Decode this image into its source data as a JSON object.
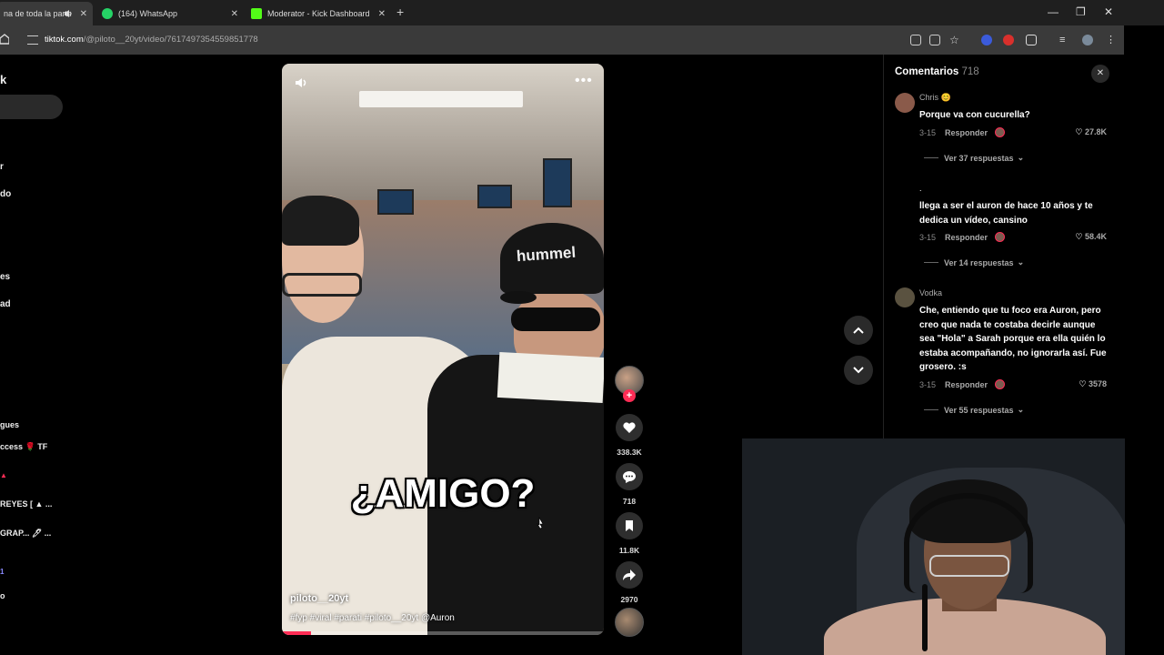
{
  "browser": {
    "tabs": [
      {
        "title": "na de toda la parte",
        "icon": "speaker-icon"
      },
      {
        "title": "(164) WhatsApp",
        "icon": "whatsapp-icon"
      },
      {
        "title": "Moderator - Kick Dashboard",
        "icon": "kick-icon"
      }
    ],
    "url_domain": "tiktok.com",
    "url_path": "/@piloto__20yt/video/7617497354559851778"
  },
  "sidebar": {
    "items": [
      {
        "label": "k"
      },
      {
        "label": "r"
      },
      {
        "label": "do"
      },
      {
        "label": "es"
      },
      {
        "label": "ad"
      },
      {
        "label": "gues"
      },
      {
        "label": "ccess 🌹 TF"
      },
      {
        "label": "▲"
      },
      {
        "label": "REYES [ ▲ ..."
      },
      {
        "label": "GRAP... 🖊 ..."
      },
      {
        "label": "1"
      },
      {
        "label": "o"
      }
    ]
  },
  "video": {
    "caption": "¿AMIGO?",
    "cap_brand": "hummel",
    "username": "piloto__20yt",
    "hashtags": "#fyp #viral #parati #piloto__20yt @Auron",
    "progress": 0.09
  },
  "actions": {
    "likes": "338.3K",
    "comments": "718",
    "saves": "11.8K",
    "shares": "2970"
  },
  "comments": {
    "title": "Comentarios",
    "count": "718",
    "items": [
      {
        "user": "Chris 😊",
        "text": "Porque va con cucurella?",
        "date": "3-15",
        "reply": "Responder",
        "likes": "27.8K",
        "view_replies": "Ver 37 respuestas",
        "avatar_color": "#8a5a4a"
      },
      {
        "user": ".",
        "text": "llega a ser el auron de hace 10 años y te dedica un vídeo, cansino",
        "date": "3-15",
        "reply": "Responder",
        "likes": "58.4K",
        "view_replies": "Ver 14 respuestas",
        "avatar_color": "#000000"
      },
      {
        "user": "Vodka",
        "text": "Che, entiendo que tu foco era Auron, pero creo que nada te costaba decirle aunque sea \"Hola\" a Sarah porque era ella quién lo estaba acompañando, no ignorarla así. Fue grosero. :s",
        "date": "3-15",
        "reply": "Responder",
        "likes": "3578",
        "view_replies": "Ver 55 respuestas",
        "avatar_color": "#5a5240"
      }
    ]
  },
  "colors": {
    "accent": "#fe2c55",
    "panel_bg": "#000000",
    "chrome_bg": "#1f1f1f"
  }
}
